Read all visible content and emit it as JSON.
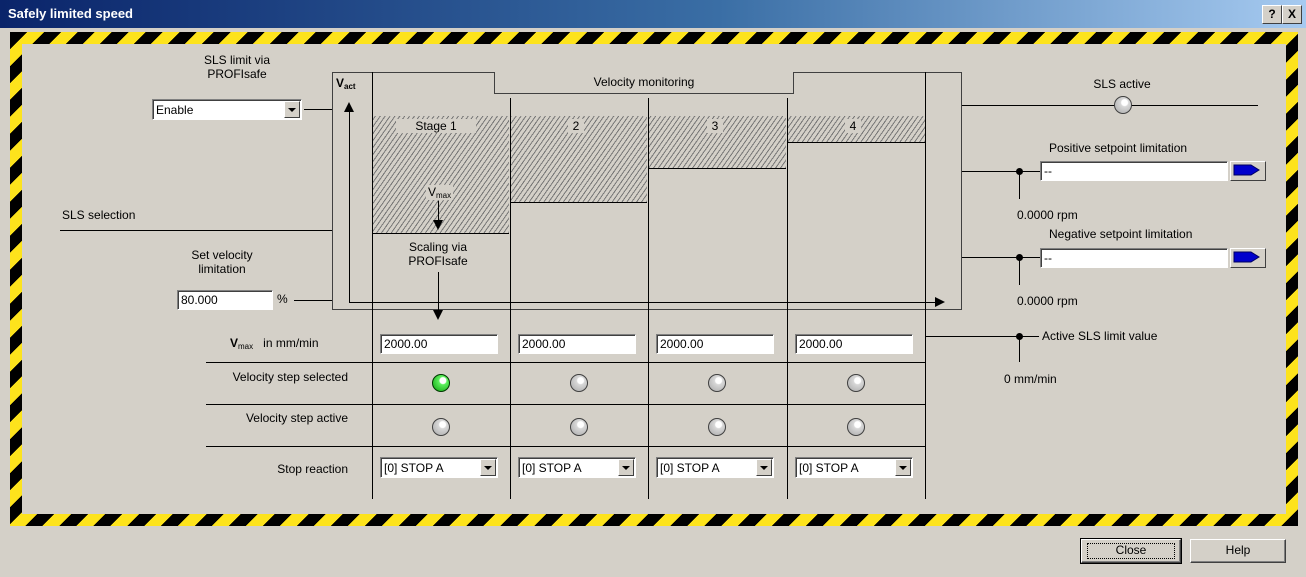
{
  "window": {
    "title": "Safely limited speed",
    "help_btn": "?",
    "close_btn": "X"
  },
  "sls_limit": {
    "label_line1": "SLS limit via",
    "label_line2": "PROFIsafe",
    "value": "Enable"
  },
  "sls_selection_label": "SLS selection",
  "set_velocity": {
    "label_line1": "Set velocity",
    "label_line2": "limitation",
    "value": "80.000",
    "unit": "%"
  },
  "diagram": {
    "vact": "V",
    "vact_sub": "act",
    "header": "Velocity monitoring",
    "stages": [
      "Stage 1",
      "2",
      "3",
      "4"
    ],
    "vmax": "V",
    "vmax_sub": "max",
    "scaling_line1": "Scaling via",
    "scaling_line2": "PROFIsafe"
  },
  "vmax_row": {
    "label_v": "V",
    "label_sub": "max",
    "label_unit": "in  mm/min",
    "values": [
      "2000.00",
      "2000.00",
      "2000.00",
      "2000.00"
    ]
  },
  "step_selected": {
    "label": "Velocity step selected",
    "states": [
      true,
      false,
      false,
      false
    ]
  },
  "step_active": {
    "label": "Velocity step active",
    "states": [
      false,
      false,
      false,
      false
    ]
  },
  "stop_reaction": {
    "label": "Stop reaction",
    "values": [
      "[0] STOP A",
      "[0] STOP A",
      "[0] STOP A",
      "[0] STOP A"
    ]
  },
  "right": {
    "sls_active": "SLS active",
    "pos_label": "Positive setpoint limitation",
    "pos_value": "--",
    "pos_rpm": "0.0000 rpm",
    "neg_label": "Negative setpoint limitation",
    "neg_value": "--",
    "neg_rpm": "0.0000 rpm",
    "active_limit_label": "Active SLS limit value",
    "active_limit_value": "0 mm/min"
  },
  "footer": {
    "close": "Close",
    "help": "Help"
  },
  "colors": {
    "stripe_yellow": "#fde31c",
    "led_on": "#0aa00a",
    "arrow_blue": "#0000cc"
  }
}
